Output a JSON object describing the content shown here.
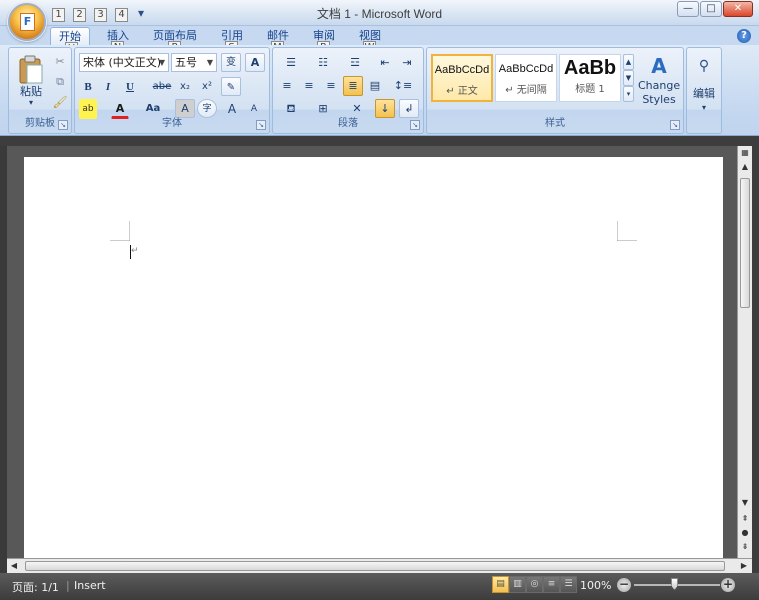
{
  "window": {
    "title": "文档 1 - Microsoft Word",
    "office_logo": "F",
    "minimize": "—",
    "maximize": "□",
    "close": "✕"
  },
  "qat": {
    "items": [
      {
        "icon": "save-icon",
        "glyph": "▫",
        "keytip": "1"
      },
      {
        "icon": "undo-icon",
        "glyph": "↶",
        "keytip": "2"
      },
      {
        "icon": "redo-icon",
        "glyph": "↷",
        "keytip": "3"
      },
      {
        "icon": "print-icon",
        "glyph": "▣",
        "keytip": "4"
      }
    ],
    "office_keytip": "F"
  },
  "tabs": [
    {
      "label": "开始",
      "keytip": "H",
      "active": true
    },
    {
      "label": "插入",
      "keytip": "N"
    },
    {
      "label": "页面布局",
      "keytip": "P"
    },
    {
      "label": "引用",
      "keytip": "S"
    },
    {
      "label": "邮件",
      "keytip": "M"
    },
    {
      "label": "审阅",
      "keytip": "R"
    },
    {
      "label": "视图",
      "keytip": "W"
    }
  ],
  "help": "?",
  "ribbon": {
    "clipboard": {
      "label": "剪贴板",
      "paste": "粘贴"
    },
    "font": {
      "label": "字体",
      "font_name": "宋体 (中文正文)",
      "font_size": "五号",
      "wen": "变",
      "A": "A",
      "bold": "B",
      "italic": "I",
      "underline": "U",
      "strike": "abe",
      "sub": "x₂",
      "sup": "x²",
      "highlight": "ab",
      "font_color": "A",
      "change_case": "Aa",
      "char_shading": "A",
      "enclose": "字",
      "grow": "A",
      "shrink": "A"
    },
    "paragraph": {
      "label": "段落"
    },
    "styles": {
      "label": "样式",
      "items": [
        {
          "sample": "AaBbCcDd",
          "name": "↵ 正文"
        },
        {
          "sample": "AaBbCcDd",
          "name": "↵ 无间隔"
        },
        {
          "sample": "AaBb",
          "name": "标题 1"
        }
      ],
      "change_styles_line1": "Change",
      "change_styles_line2": "Styles"
    },
    "editing": {
      "label": "编辑"
    }
  },
  "document": {
    "paragraph_mark": "↵"
  },
  "status": {
    "page": "页面: 1/1",
    "mode": "Insert",
    "zoom": "100%",
    "zoom_fraction": 0.5
  },
  "colors": {
    "accent": "#15428b",
    "ribbon": "#c6d9f1",
    "status": "#4a4a4a"
  }
}
